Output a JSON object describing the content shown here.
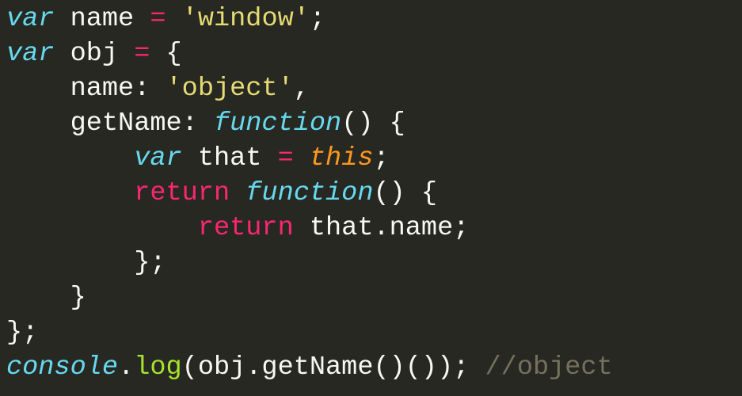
{
  "code": {
    "language": "javascript",
    "line1": {
      "var": "var",
      "sp": " ",
      "name": "name ",
      "eq": "=",
      "sp2": " ",
      "str": "'window'",
      "end": ";"
    },
    "line2": {
      "var": "var",
      "sp": " ",
      "name": "obj ",
      "eq": "=",
      "sp2": " ",
      "brace": "{"
    },
    "line3": {
      "indent": "    ",
      "key": "name",
      "colon": ": ",
      "str": "'object'",
      "comma": ","
    },
    "line4": {
      "indent": "    ",
      "key": "getName",
      "colon": ": ",
      "fn": "function",
      "parens": "() {"
    },
    "line5": {
      "indent": "        ",
      "var": "var",
      "sp": " ",
      "that": "that ",
      "eq": "=",
      "sp2": " ",
      "this": "this",
      "end": ";"
    },
    "line6": {
      "indent": "        ",
      "ret": "return",
      "sp": " ",
      "fn": "function",
      "parens": "() {"
    },
    "line7": {
      "indent": "            ",
      "ret": "return",
      "sp": " ",
      "expr": "that.name;"
    },
    "line8": {
      "indent": "        ",
      "close": "};"
    },
    "line9": {
      "indent": "    ",
      "close": "}"
    },
    "line10": {
      "close": "};"
    },
    "line11": {
      "console": "console",
      "dot": ".",
      "log": "log",
      "args": "(obj.getName()()); ",
      "comment": "//object"
    }
  }
}
